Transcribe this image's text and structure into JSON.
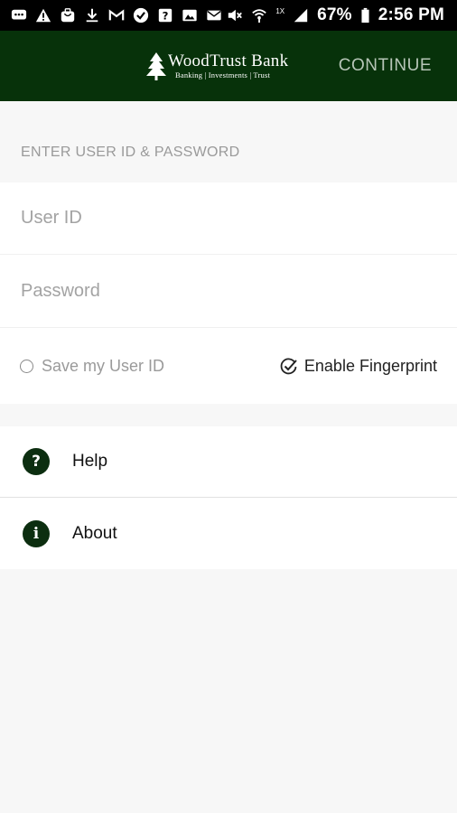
{
  "status_bar": {
    "battery_percent": "67%",
    "time": "2:56 PM",
    "network_label": "1X",
    "left_icons": [
      "chat-icon",
      "alert-icon",
      "bag-icon",
      "download-icon",
      "gmail-icon",
      "check-badge-icon",
      "question-box-icon",
      "image-icon",
      "mail-icon"
    ],
    "right_icons": [
      "mute-icon",
      "wifi-icon",
      "signal-icon",
      "battery-icon"
    ]
  },
  "header": {
    "logo_title": "WoodTrust Bank",
    "logo_subtitle": "Banking | Investments | Trust",
    "continue_label": "CONTINUE",
    "background_color": "#07320a"
  },
  "login": {
    "section_label": "ENTER USER ID & PASSWORD",
    "user_id_placeholder": "User ID",
    "password_placeholder": "Password",
    "save_user_id_label": "Save my User ID",
    "save_user_id_checked": false,
    "enable_fingerprint_label": "Enable Fingerprint",
    "enable_fingerprint_checked": true
  },
  "menu": {
    "items": [
      {
        "label": "Help",
        "icon": "help-icon",
        "glyph": "?"
      },
      {
        "label": "About",
        "icon": "info-icon",
        "glyph": "i"
      }
    ]
  }
}
